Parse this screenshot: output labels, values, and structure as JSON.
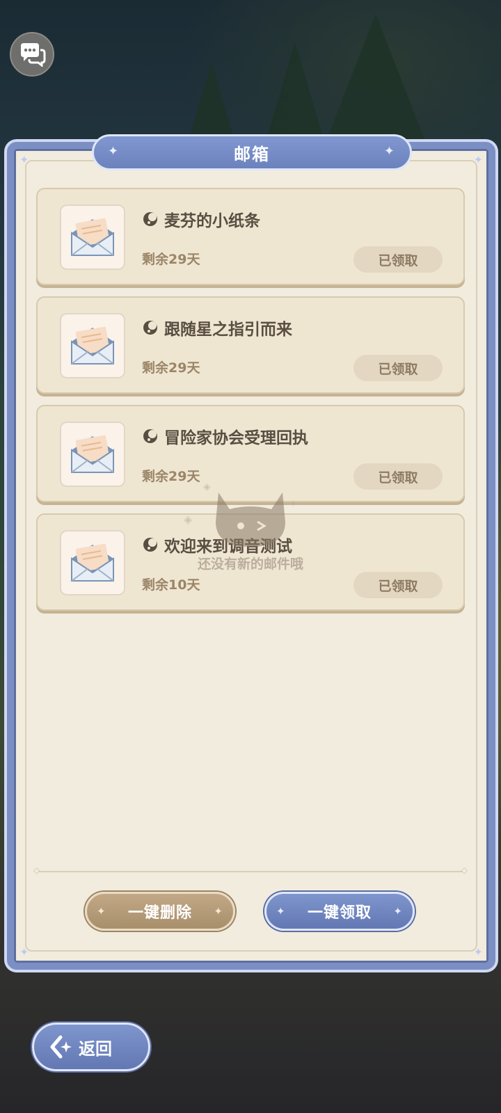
{
  "top": {
    "chat_icon": "chat-bubbles-icon"
  },
  "mailbox": {
    "title": "邮箱",
    "mails": [
      {
        "title": "麦芬的小纸条",
        "remaining": "剩余29天",
        "status": "已领取",
        "icon": "open-envelope-icon",
        "sender_icon": "moon-seal-icon"
      },
      {
        "title": "跟随星之指引而来",
        "remaining": "剩余29天",
        "status": "已领取",
        "icon": "open-envelope-icon",
        "sender_icon": "moon-seal-icon"
      },
      {
        "title": "冒险家协会受理回执",
        "remaining": "剩余29天",
        "status": "已领取",
        "icon": "open-envelope-icon",
        "sender_icon": "moon-seal-icon"
      },
      {
        "title": "欢迎来到调音测试",
        "remaining": "剩余10天",
        "status": "已领取",
        "icon": "open-envelope-icon",
        "sender_icon": "moon-seal-icon"
      }
    ],
    "empty_text": "还没有新的邮件哦",
    "delete_all_label": "一键删除",
    "claim_all_label": "一键领取"
  },
  "back": {
    "label": "返回",
    "icon": "back-arrow-icon"
  },
  "colors": {
    "panel_border": "#7b8fc4",
    "panel_bg": "#f2ecdf",
    "delete_btn": "#a88f6b",
    "claim_btn": "#6f84bd"
  }
}
